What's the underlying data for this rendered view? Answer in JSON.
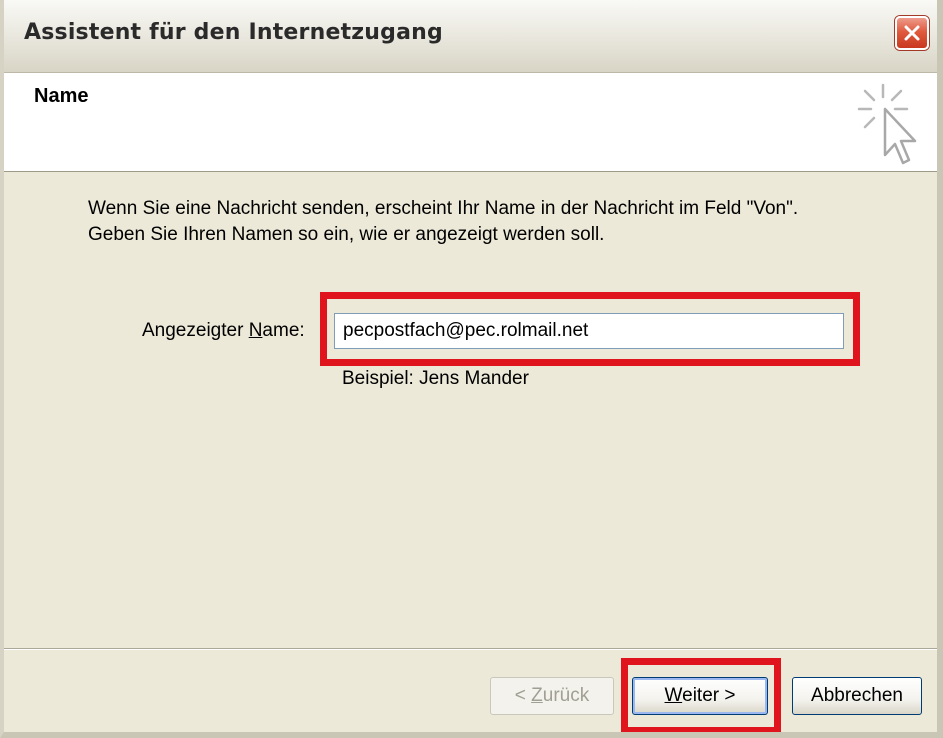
{
  "window": {
    "title": "Assistent für den Internetzugang"
  },
  "header": {
    "title": "Name",
    "icon": "wizard-cursor-icon"
  },
  "content": {
    "description_line1": "Wenn Sie eine Nachricht senden, erscheint Ihr Name in der Nachricht im Feld \"Von\".",
    "description_line2": "Geben Sie Ihren Namen so ein, wie er angezeigt werden soll.",
    "field_label_prefix": "Angezeigter ",
    "field_label_accel": "N",
    "field_label_suffix": "ame:",
    "field_value": "pecpostfach@pec.rolmail.net",
    "hint": "Beispiel: Jens Mander"
  },
  "buttons": {
    "back_prefix": "< ",
    "back_accel": "Z",
    "back_suffix": "urück",
    "next_accel": "W",
    "next_suffix": "eiter >",
    "cancel": "Abbrechen"
  },
  "colors": {
    "highlight": "#e0141c",
    "dialog_bg": "#ece9d8"
  }
}
